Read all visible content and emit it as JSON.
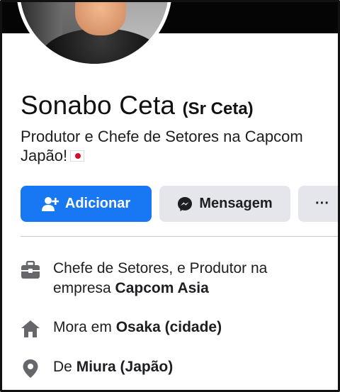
{
  "profile": {
    "name": "Sonabo Ceta",
    "alternate_name": "(Sr Ceta)",
    "bio": "Produtor e Chefe de Setores na Capcom Japão!"
  },
  "actions": {
    "add_label": "Adicionar",
    "message_label": "Mensagem",
    "more_label": "···"
  },
  "intro": {
    "work_prefix": "Chefe de Setores, e Produtor na empresa",
    "work_company": "Capcom Asia",
    "home_prefix": "Mora em",
    "home_city": "Osaka (cidade)",
    "from_prefix": "De",
    "from_place": "Miura (Japão)"
  },
  "colors": {
    "primary_button": "#1877f2",
    "secondary_button": "#e4e6eb",
    "icon_gray": "#65676b",
    "cover_band": "#050505"
  },
  "icons": {
    "add": "add-friend-icon",
    "message": "messenger-icon",
    "more": "more-dots-icon",
    "work": "briefcase-icon",
    "home": "house-icon",
    "from": "location-pin-icon",
    "flag": "japan-flag-icon"
  }
}
